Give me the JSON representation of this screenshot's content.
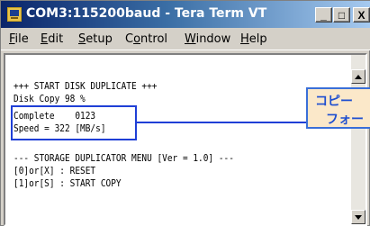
{
  "window": {
    "title": "COM3:115200baud - Tera Term VT",
    "buttons": {
      "minimize": "_",
      "maximize": "□",
      "close": "X"
    }
  },
  "menu": {
    "items": [
      "File",
      "Edit",
      "Setup",
      "Control",
      "Window",
      "Help"
    ],
    "accelerators": [
      "F",
      "E",
      "S",
      "o",
      "W",
      "H"
    ]
  },
  "terminal": {
    "lines": [
      "+++ START DISK DUPLICATE +++",
      "Disk Copy 98 %",
      "Complete    0123",
      "Speed = 322 [MB/s]",
      "",
      "--- STORAGE DUPLICATOR MENU [Ver = 1.0] ---",
      "[0]or[X] : RESET",
      "[1]or[S] : START COPY"
    ]
  },
  "callout": {
    "line1": "コピー",
    "line2": "フォー"
  },
  "colors": {
    "highlight_border": "#1f3fd6",
    "callout_fill": "#fbe8c9",
    "callout_text": "#1f4fd0"
  },
  "icons": [
    "teraterm-app-icon",
    "scroll-up-icon",
    "scroll-down-icon"
  ]
}
